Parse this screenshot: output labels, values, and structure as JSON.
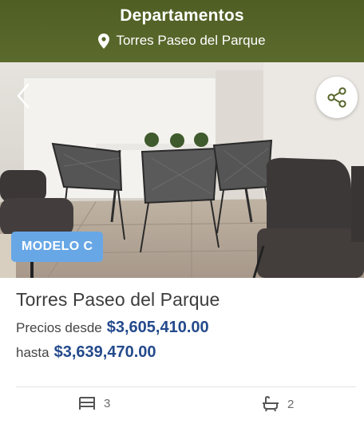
{
  "header": {
    "title": "Departamentos",
    "location": "Torres Paseo del Parque",
    "location_icon": "map-pin-icon"
  },
  "gallery": {
    "prev_icon": "chevron-left-icon",
    "share_icon": "share-icon",
    "badge": "MODELO C"
  },
  "listing": {
    "title": "Torres Paseo del Parque",
    "price_from_label": "Precios desde",
    "price_from": "$3,605,410.00",
    "price_to_label": "hasta",
    "price_to": "$3,639,470.00"
  },
  "features": {
    "bedrooms": "3",
    "bedrooms_icon": "bed-icon",
    "bathrooms": "2",
    "bathrooms_icon": "bathtub-icon"
  },
  "colors": {
    "header_bg": "#56652a",
    "badge_bg": "#68a7e6",
    "price": "#244a8c"
  }
}
